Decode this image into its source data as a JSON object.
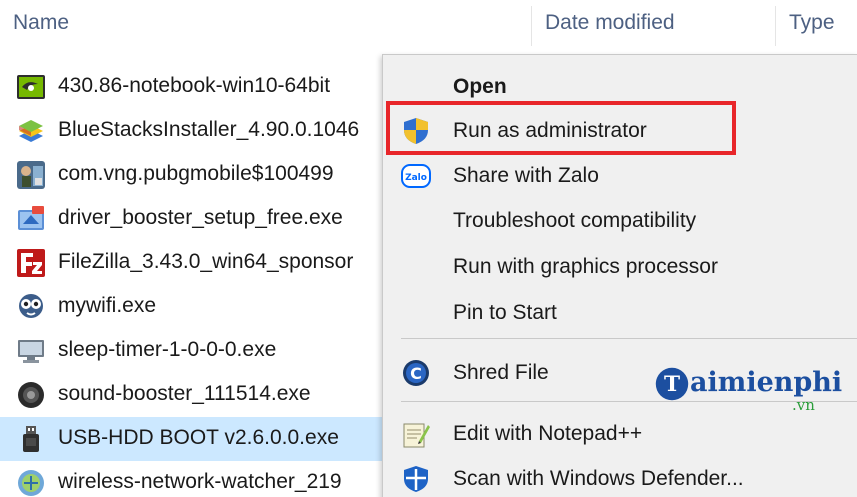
{
  "columns": {
    "name": "Name",
    "date_modified": "Date modified",
    "type": "Type"
  },
  "files": [
    {
      "name": "430.86-notebook-win10-64bit",
      "icon": "nvidia-icon"
    },
    {
      "name": "BlueStacksInstaller_4.90.0.1046",
      "icon": "bluestacks-icon"
    },
    {
      "name": "com.vng.pubgmobile$100499",
      "icon": "pubg-icon"
    },
    {
      "name": "driver_booster_setup_free.exe",
      "icon": "driver-booster-icon"
    },
    {
      "name": "FileZilla_3.43.0_win64_sponsor",
      "icon": "filezilla-icon"
    },
    {
      "name": "mywifi.exe",
      "icon": "mywifi-icon"
    },
    {
      "name": "sleep-timer-1-0-0-0.exe",
      "icon": "sleep-timer-icon"
    },
    {
      "name": "sound-booster_111514.exe",
      "icon": "sound-booster-icon"
    },
    {
      "name": "USB-HDD BOOT v2.6.0.0.exe",
      "icon": "usb-drive-icon",
      "selected": true
    },
    {
      "name": "wireless-network-watcher_219",
      "icon": "wireless-watcher-icon"
    }
  ],
  "context_menu": {
    "items": [
      {
        "label": "Open",
        "bold": true
      },
      {
        "label": "Run as administrator",
        "icon": "uac-shield-icon",
        "highlighted": true
      },
      {
        "label": "Share with Zalo",
        "icon": "zalo-icon"
      },
      {
        "label": "Troubleshoot compatibility"
      },
      {
        "label": "Run with graphics processor"
      },
      {
        "label": "Pin to Start"
      },
      {
        "label": "Shred File",
        "icon": "shred-file-icon"
      },
      {
        "label": "Edit with Notepad++",
        "icon": "notepadpp-icon"
      },
      {
        "label": "Scan with Windows Defender...",
        "icon": "windows-defender-icon"
      }
    ]
  },
  "watermark": {
    "text": "aimienphi",
    "suffix": ".vn",
    "logo_letter": "T"
  },
  "colors": {
    "header_text": "#4d6082",
    "selection": "#cce8ff",
    "menu_background": "#f0f0f0",
    "highlight_border": "#e8262a",
    "watermark_blue": "#1c4fa0",
    "watermark_green": "#2a9d3a"
  }
}
